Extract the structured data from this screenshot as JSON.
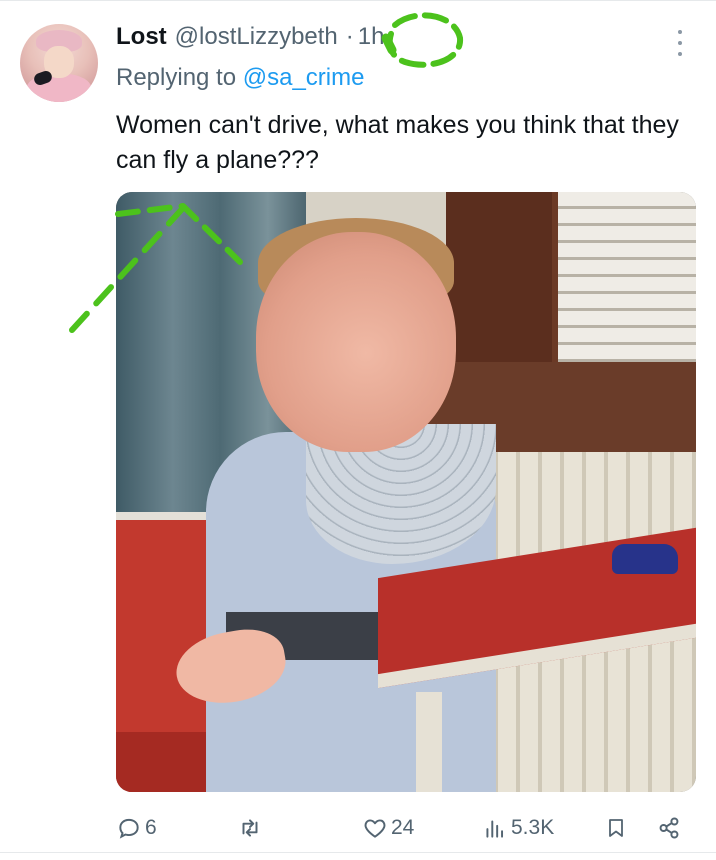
{
  "tweet": {
    "display_name": "Lost",
    "handle": "@lostLizzybeth",
    "separator": "·",
    "time": "1h",
    "replying_prefix": "Replying to",
    "replying_to": "@sa_crime",
    "text": "Women can't drive, what makes you think that they can fly a plane???"
  },
  "actions": {
    "replies": "6",
    "reposts": "",
    "likes": "24",
    "views": "5.3K"
  },
  "icons": {
    "more": "more-vertical-icon",
    "reply": "reply-icon",
    "repost": "repost-icon",
    "like": "heart-icon",
    "views": "views-icon",
    "bookmark": "bookmark-icon",
    "share": "share-icon"
  },
  "colors": {
    "text": "#0f1419",
    "secondary": "#536471",
    "link": "#1d9bf0",
    "annotation": "#4cc21c"
  }
}
